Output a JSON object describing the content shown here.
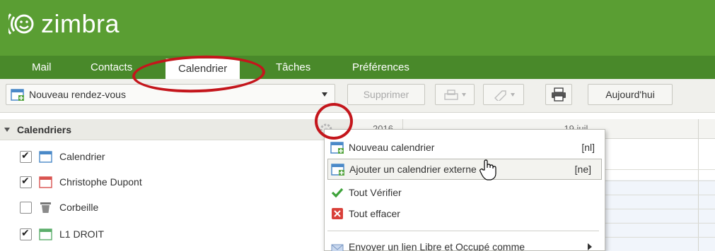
{
  "app": {
    "name": "zimbra"
  },
  "tabs": [
    {
      "label": "Mail"
    },
    {
      "label": "Contacts"
    },
    {
      "label": "Calendrier"
    },
    {
      "label": "Tâches"
    },
    {
      "label": "Préférences"
    }
  ],
  "toolbar": {
    "new_appointment": "Nouveau rendez-vous",
    "delete": "Supprimer",
    "today": "Aujourd'hui"
  },
  "sidebar": {
    "header": "Calendriers",
    "items": [
      {
        "label": "Calendrier",
        "checked": true,
        "color": "#4a89c8",
        "icon": "calendar-icon"
      },
      {
        "label": "Christophe Dupont",
        "checked": true,
        "color": "#d9534f",
        "icon": "calendar-icon"
      },
      {
        "label": "Corbeille",
        "checked": false,
        "color": "#7a7a7a",
        "icon": "trash-icon"
      },
      {
        "label": "L1 DROIT",
        "checked": true,
        "color": "#5cae6b",
        "icon": "calendar-icon"
      }
    ]
  },
  "calendar": {
    "date_fragment_left": "2016",
    "date_fragment_right": "... 19 juil..."
  },
  "context_menu": {
    "items": [
      {
        "label": "Nouveau calendrier",
        "shortcut": "[nl]",
        "icon": "new-calendar-icon"
      },
      {
        "label": "Ajouter un calendrier externe",
        "shortcut": "[ne]",
        "icon": "add-external-calendar-icon"
      },
      {
        "label": "Tout Vérifier",
        "shortcut": "",
        "icon": "checkmark-icon"
      },
      {
        "label": "Tout effacer",
        "shortcut": "",
        "icon": "clear-x-icon"
      },
      {
        "label": "Envoyer un lien Libre et Occupé comme",
        "shortcut": "",
        "icon": "mail-icon"
      }
    ]
  },
  "colors": {
    "header_green": "#5a9e33",
    "tab_bar_green": "#49892a",
    "highlight_red": "#c4161c"
  }
}
